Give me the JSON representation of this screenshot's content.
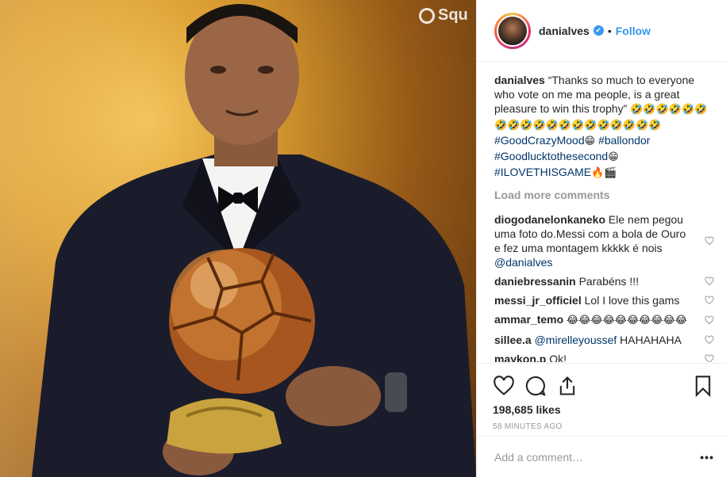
{
  "post": {
    "watermark": "Squ"
  },
  "header": {
    "username": "danialves",
    "verified_mark": "✔",
    "separator": "•",
    "follow_label": "Follow"
  },
  "caption": {
    "username": "danialves",
    "text": "“Thanks so much to everyone who vote on me ma people, is a great pleasure to win this trophy”",
    "emoji_run": "🤣🤣🤣🤣🤣🤣🤣🤣🤣🤣🤣🤣🤣🤣🤣🤣🤣🤣🤣",
    "tag1": "#GoodCrazyMood",
    "tag1_emoji": "😁",
    "tag2": "#ballondor",
    "tag3": "#Goodlucktothesecond",
    "tag3_emoji": "😁",
    "tag4": "#ILOVETHISGAME",
    "tag4_emoji": "🔥🎬"
  },
  "load_more": "Load more comments",
  "comments": [
    {
      "user": "diogodanelonkaneko",
      "text": "Ele nem pegou uma foto do.Messi com a bola de Ouro e fez uma montagem kkkkk é nois",
      "mention": "@danialves"
    },
    {
      "user": "daniebressanin",
      "text": "Parabéns !!!",
      "mention": ""
    },
    {
      "user": "messi_jr_officiel",
      "text": "Lol I love this gams",
      "mention": ""
    },
    {
      "user": "ammar_temo",
      "text": "😂😂😂😂😂😂😂😂😂😂",
      "mention": ""
    },
    {
      "user": "sillee.a",
      "text": "HAHAHAHA",
      "mention": "@mirelleyoussef"
    },
    {
      "user": "maykon.p",
      "text": "Ok!",
      "mention": ""
    }
  ],
  "actions": {
    "likes": "198,685 likes",
    "time": "58 MINUTES AGO"
  },
  "add_comment": {
    "placeholder": "Add a comment…",
    "more": "•••"
  },
  "colors": {
    "link": "#003569",
    "follow": "#3897f0",
    "muted": "#999999"
  }
}
